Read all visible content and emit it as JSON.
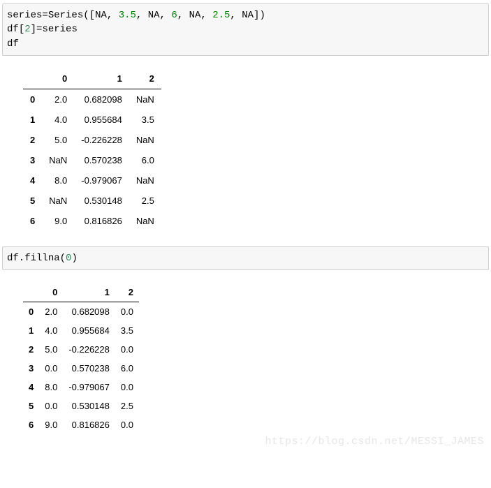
{
  "code1": {
    "tokens": [
      {
        "t": "series",
        "c": "p-black"
      },
      {
        "t": "=",
        "c": "p-black"
      },
      {
        "t": "Series",
        "c": "p-black"
      },
      {
        "t": "(",
        "c": "p-black"
      },
      {
        "t": "[",
        "c": "p-black"
      },
      {
        "t": "NA",
        "c": "p-black"
      },
      {
        "t": ", ",
        "c": "p-black"
      },
      {
        "t": "3.5",
        "c": "p-green"
      },
      {
        "t": ", ",
        "c": "p-black"
      },
      {
        "t": "NA",
        "c": "p-black"
      },
      {
        "t": ", ",
        "c": "p-black"
      },
      {
        "t": "6",
        "c": "p-green"
      },
      {
        "t": ", ",
        "c": "p-black"
      },
      {
        "t": "NA",
        "c": "p-black"
      },
      {
        "t": ", ",
        "c": "p-black"
      },
      {
        "t": "2.5",
        "c": "p-green"
      },
      {
        "t": ", ",
        "c": "p-black"
      },
      {
        "t": "NA",
        "c": "p-black"
      },
      {
        "t": "]",
        "c": "p-black"
      },
      {
        "t": ")",
        "c": "p-black"
      },
      {
        "t": "\n",
        "c": "p-black"
      },
      {
        "t": "df",
        "c": "p-black"
      },
      {
        "t": "[",
        "c": "p-black"
      },
      {
        "t": "2",
        "c": "p-teal"
      },
      {
        "t": "]",
        "c": "p-black"
      },
      {
        "t": "=",
        "c": "p-black"
      },
      {
        "t": "series",
        "c": "p-black"
      },
      {
        "t": "\n",
        "c": "p-black"
      },
      {
        "t": "df",
        "c": "p-black"
      }
    ]
  },
  "table1": {
    "columns": [
      "0",
      "1",
      "2"
    ],
    "index": [
      "0",
      "1",
      "2",
      "3",
      "4",
      "5",
      "6"
    ],
    "rows": [
      [
        "2.0",
        "0.682098",
        "NaN"
      ],
      [
        "4.0",
        "0.955684",
        "3.5"
      ],
      [
        "5.0",
        "-0.226228",
        "NaN"
      ],
      [
        "NaN",
        "0.570238",
        "6.0"
      ],
      [
        "8.0",
        "-0.979067",
        "NaN"
      ],
      [
        "NaN",
        "0.530148",
        "2.5"
      ],
      [
        "9.0",
        "0.816826",
        "NaN"
      ]
    ]
  },
  "code2": {
    "tokens": [
      {
        "t": "df.",
        "c": "p-black"
      },
      {
        "t": "fillna",
        "c": "p-black"
      },
      {
        "t": "(",
        "c": "p-black"
      },
      {
        "t": "0",
        "c": "p-teal"
      },
      {
        "t": ")",
        "c": "p-black"
      }
    ]
  },
  "table2": {
    "columns": [
      "0",
      "1",
      "2"
    ],
    "index": [
      "0",
      "1",
      "2",
      "3",
      "4",
      "5",
      "6"
    ],
    "rows": [
      [
        "2.0",
        "0.682098",
        "0.0"
      ],
      [
        "4.0",
        "0.955684",
        "3.5"
      ],
      [
        "5.0",
        "-0.226228",
        "0.0"
      ],
      [
        "0.0",
        "0.570238",
        "6.0"
      ],
      [
        "8.0",
        "-0.979067",
        "0.0"
      ],
      [
        "0.0",
        "0.530148",
        "2.5"
      ],
      [
        "9.0",
        "0.816826",
        "0.0"
      ]
    ]
  },
  "watermark": "https://blog.csdn.net/MESSI_JAMES"
}
